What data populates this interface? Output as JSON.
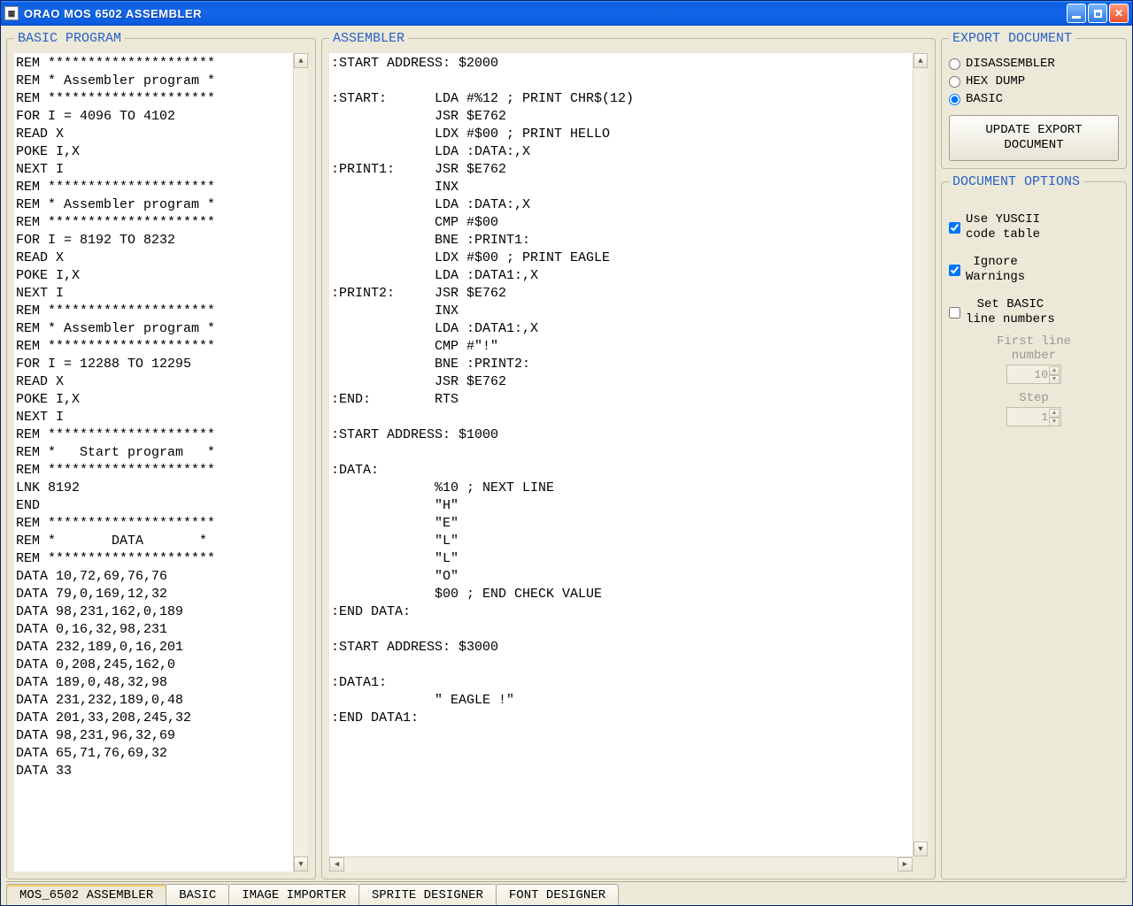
{
  "window": {
    "title": "ORAO  MOS 6502 ASSEMBLER"
  },
  "panels": {
    "basic_title": "BASIC PROGRAM",
    "assembler_title": "ASSEMBLER",
    "export_title": "EXPORT DOCUMENT",
    "options_title": "DOCUMENT OPTIONS"
  },
  "basic_code": "REM *********************\nREM * Assembler program *\nREM *********************\nFOR I = 4096 TO 4102\nREAD X\nPOKE I,X\nNEXT I\nREM *********************\nREM * Assembler program *\nREM *********************\nFOR I = 8192 TO 8232\nREAD X\nPOKE I,X\nNEXT I\nREM *********************\nREM * Assembler program *\nREM *********************\nFOR I = 12288 TO 12295\nREAD X\nPOKE I,X\nNEXT I\nREM *********************\nREM *   Start program   *\nREM *********************\nLNK 8192\nEND\nREM *********************\nREM *       DATA       *\nREM *********************\nDATA 10,72,69,76,76\nDATA 79,0,169,12,32\nDATA 98,231,162,0,189\nDATA 0,16,32,98,231\nDATA 232,189,0,16,201\nDATA 0,208,245,162,0\nDATA 189,0,48,32,98\nDATA 231,232,189,0,48\nDATA 201,33,208,245,32\nDATA 98,231,96,32,69\nDATA 65,71,76,69,32\nDATA 33",
  "asm_code": ":START ADDRESS: $2000\n\n:START:      LDA #%12 ; PRINT CHR$(12)\n             JSR $E762\n             LDX #$00 ; PRINT HELLO\n             LDA :DATA:,X\n:PRINT1:     JSR $E762\n             INX\n             LDA :DATA:,X\n             CMP #$00\n             BNE :PRINT1:\n             LDX #$00 ; PRINT EAGLE\n             LDA :DATA1:,X\n:PRINT2:     JSR $E762\n             INX\n             LDA :DATA1:,X\n             CMP #\"!\"\n             BNE :PRINT2:\n             JSR $E762\n:END:        RTS\n\n:START ADDRESS: $1000\n\n:DATA:\n             %10 ; NEXT LINE\n             \"H\"\n             \"E\"\n             \"L\"\n             \"L\"\n             \"O\"\n             $00 ; END CHECK VALUE\n:END DATA:\n\n:START ADDRESS: $3000\n\n:DATA1:\n             \" EAGLE !\"\n:END DATA1:",
  "export": {
    "radio_disassembler": "DISASSEMBLER",
    "radio_hexdump": "HEX DUMP",
    "radio_basic": "BASIC",
    "selected": "basic",
    "update_btn": "UPDATE EXPORT\nDOCUMENT"
  },
  "options": {
    "use_yuscii": "Use YUSCII\ncode table",
    "ignore_warnings": "Ignore\nWarnings",
    "set_line_numbers": "Set BASIC\nline numbers",
    "use_yuscii_checked": true,
    "ignore_warnings_checked": true,
    "set_line_checked": false,
    "first_line_label": "First line\nnumber",
    "first_line_value": "10",
    "step_label": "Step",
    "step_value": "1"
  },
  "tabs": {
    "t1": "MOS_6502 ASSEMBLER",
    "t2": "BASIC",
    "t3": "IMAGE IMPORTER",
    "t4": "SPRITE DESIGNER",
    "t5": "FONT DESIGNER"
  }
}
